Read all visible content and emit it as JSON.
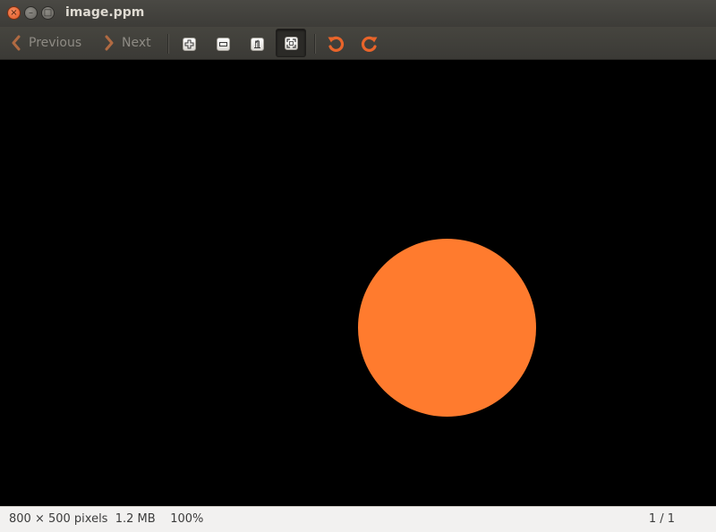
{
  "window": {
    "title": "image.ppm",
    "controls": {
      "close": "×",
      "minimize": "–",
      "maximize": "□"
    }
  },
  "toolbar": {
    "previous_label": "Previous",
    "next_label": "Next",
    "tools": [
      {
        "name": "zoom-in",
        "icon": "zoom-in-icon"
      },
      {
        "name": "zoom-out",
        "icon": "zoom-out-icon"
      },
      {
        "name": "normal-size",
        "icon": "normal-size-icon"
      },
      {
        "name": "best-fit",
        "icon": "best-fit-icon",
        "active": true
      },
      {
        "name": "rotate-left",
        "icon": "rotate-counterclockwise-icon"
      },
      {
        "name": "rotate-right",
        "icon": "rotate-clockwise-icon"
      }
    ]
  },
  "image": {
    "background_color": "#000000",
    "shape": "circle",
    "fill_color": "#ff7b2e"
  },
  "status": {
    "dimensions": "800 × 500 pixels",
    "file_size": "1.2 MB",
    "zoom": "100%",
    "position": "1 / 1"
  },
  "colors": {
    "accent": "#e0622a",
    "rotate_icon": "#e8642a"
  }
}
